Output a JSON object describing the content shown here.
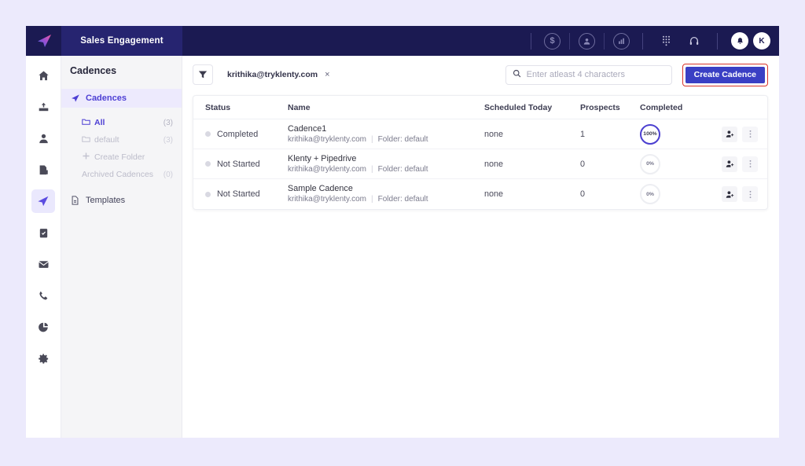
{
  "colors": {
    "page_background": "#eceafc",
    "topbar": "#1b1a52",
    "brand_block": "#262470",
    "accent": "#4d3fd4",
    "primary_button": "#3a3fc4",
    "highlight_outline": "#d7342a",
    "sidebar": "#f5f5f7"
  },
  "topbar": {
    "logo_icon": "paper-plane-logo-icon",
    "brand": "Sales Engagement",
    "icons": [
      {
        "name": "dollar-circle-icon",
        "glyph": "$"
      },
      {
        "name": "user-circle-icon",
        "glyph": "●"
      },
      {
        "name": "analytics-circle-icon",
        "glyph": "█"
      },
      {
        "name": "dialpad-icon",
        "glyph": "∷"
      },
      {
        "name": "headset-support-icon",
        "glyph": "∩"
      }
    ],
    "notifications_icon": "bell-icon",
    "avatar_initial": "K"
  },
  "rail": {
    "items": [
      {
        "name": "home-icon",
        "label": "Home"
      },
      {
        "name": "inbox-icon",
        "label": "Inbox"
      },
      {
        "name": "prospects-icon",
        "label": "Prospects"
      },
      {
        "name": "reports-doc-icon",
        "label": "Reports"
      },
      {
        "name": "cadences-send-icon",
        "label": "Cadences",
        "active": true
      },
      {
        "name": "tasks-clipboard-icon",
        "label": "Tasks"
      },
      {
        "name": "mail-icon",
        "label": "Mail"
      },
      {
        "name": "calls-phone-icon",
        "label": "Calls"
      },
      {
        "name": "analytics-pie-icon",
        "label": "Analytics"
      },
      {
        "name": "settings-gear-icon",
        "label": "Settings"
      }
    ]
  },
  "sidebar": {
    "title": "Cadences",
    "primary_item": {
      "label": "Cadences",
      "icon": "send-icon"
    },
    "folders": [
      {
        "label": "All",
        "count": "(3)",
        "icon": "folder-icon",
        "selected": true
      },
      {
        "label": "default",
        "count": "(3)",
        "icon": "folder-icon",
        "selected": false
      },
      {
        "label": "Create Folder",
        "count": "",
        "icon": "plus-icon",
        "selected": false
      },
      {
        "label": "Archived Cadences",
        "count": "(0)",
        "icon": "",
        "selected": false
      }
    ],
    "templates": {
      "label": "Templates",
      "icon": "document-icon"
    }
  },
  "toolbar": {
    "filter_icon": "filter-funnel-icon",
    "chip": {
      "label": "krithika@tryklenty.com",
      "close_icon": "close-icon",
      "close_glyph": "×"
    },
    "search": {
      "icon": "search-icon",
      "value": "",
      "placeholder": "Enter atleast 4 characters"
    },
    "create_button": "Create Cadence"
  },
  "table": {
    "columns": [
      "Status",
      "Name",
      "Scheduled Today",
      "Prospects",
      "Completed"
    ],
    "rows": [
      {
        "status": "Completed",
        "name": "Cadence1",
        "owner": "krithika@tryklenty.com",
        "folder": "Folder: default",
        "scheduled_today": "none",
        "prospects": "1",
        "completed": "100%",
        "completed_full": true
      },
      {
        "status": "Not Started",
        "name": "Klenty + Pipedrive",
        "owner": "krithika@tryklenty.com",
        "folder": "Folder: default",
        "scheduled_today": "none",
        "prospects": "0",
        "completed": "0%",
        "completed_full": false
      },
      {
        "status": "Not Started",
        "name": "Sample Cadence",
        "owner": "krithika@tryklenty.com",
        "folder": "Folder: default",
        "scheduled_today": "none",
        "prospects": "0",
        "completed": "0%",
        "completed_full": false
      }
    ],
    "row_actions": [
      {
        "name": "add-prospect-button",
        "icon": "add-person-icon"
      },
      {
        "name": "row-menu-button",
        "icon": "vertical-dots-icon"
      }
    ]
  }
}
